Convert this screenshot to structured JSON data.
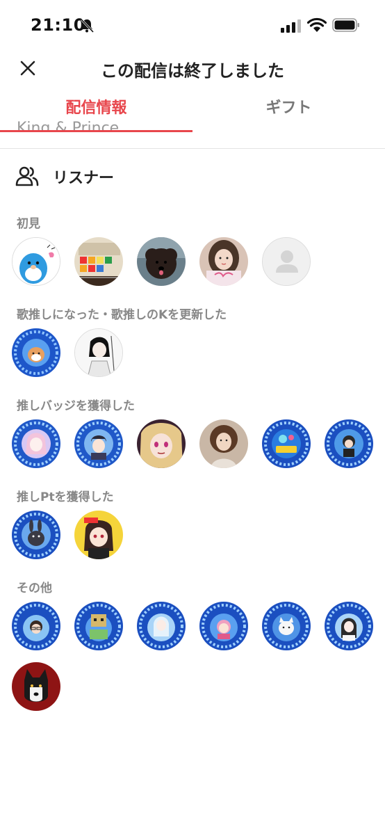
{
  "status_bar": {
    "time": "21:10"
  },
  "nav": {
    "title": "この配信は終了しました"
  },
  "tabs": [
    {
      "label": "配信情報",
      "active": true
    },
    {
      "label": "ギフト",
      "active": false
    }
  ],
  "clipped_previous_text": "King & Prince",
  "listeners": {
    "title": "リスナー",
    "sections": [
      {
        "label": "初見",
        "avatars": [
          "seal-character",
          "synth-instrument",
          "poodle-dog",
          "girl-photo-oshi",
          "default-user"
        ]
      },
      {
        "label": "歌推しになった・歌推しのKを更新した",
        "avatars": [
          "shiba-badge-blue",
          "anime-boy-sketch"
        ]
      },
      {
        "label": "推しバッジを獲得した",
        "avatars": [
          "anime-girl-badge-blue",
          "anime-boy-badge-blue",
          "anime-girl-blonde",
          "woman-curly-hair",
          "game-badge-blue",
          "chibi-badge-blue"
        ]
      },
      {
        "label": "推しPtを獲得した",
        "avatars": [
          "rabbit-badge-blue",
          "anime-girl-yellow"
        ]
      },
      {
        "label": "その他",
        "avatars": [
          "nao-badge-blue",
          "robot-badge-blue",
          "mermaid-badge-blue",
          "yuke-badge-blue",
          "cat-badge-blue",
          "kaisen-badge-blue",
          "husky-dog-red"
        ]
      }
    ]
  },
  "colors": {
    "accent": "#e8464c",
    "section_label": "#888888",
    "badge_blue": "#2a5fd1"
  }
}
